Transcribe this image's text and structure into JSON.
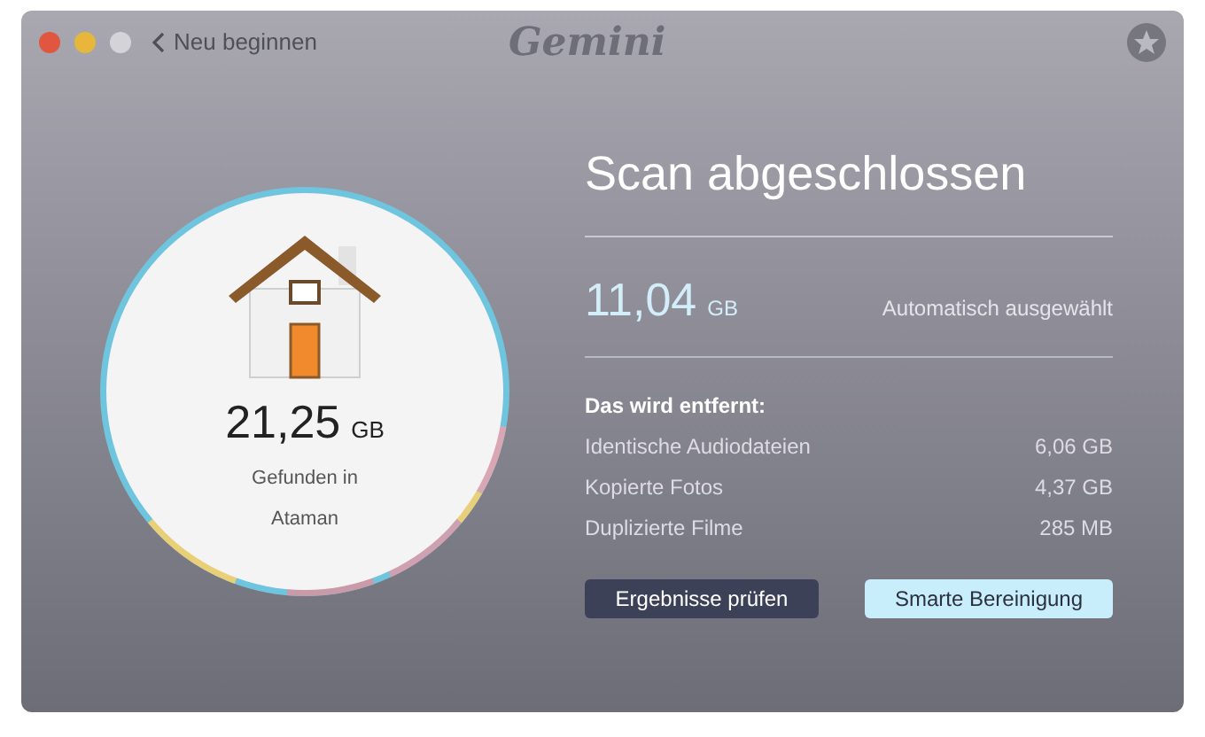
{
  "window": {
    "controls": [
      {
        "color": "#e2553f"
      },
      {
        "color": "#e6b73a"
      },
      {
        "color": "#d4d4d8"
      }
    ],
    "back_label": "Neu beginnen",
    "title": "Gemini"
  },
  "summary": {
    "size": "21,25",
    "unit": "GB",
    "caption": "Gefunden in",
    "location": "Ataman"
  },
  "result": {
    "title": "Scan abgeschlossen",
    "size": "11,04",
    "unit": "GB",
    "note": "Automatisch ausgewählt",
    "list_title": "Das wird entfernt:",
    "items": [
      {
        "label": "Identische Audiodateien",
        "value": "6,06 GB"
      },
      {
        "label": "Kopierte Fotos",
        "value": "4,37 GB"
      },
      {
        "label": "Duplizierte Filme",
        "value": "285 MB"
      }
    ]
  },
  "buttons": [
    {
      "label": "Ergebnisse prüfen",
      "kind": "secondary"
    },
    {
      "label": "Smarte Bereinigung",
      "kind": "primary"
    }
  ]
}
